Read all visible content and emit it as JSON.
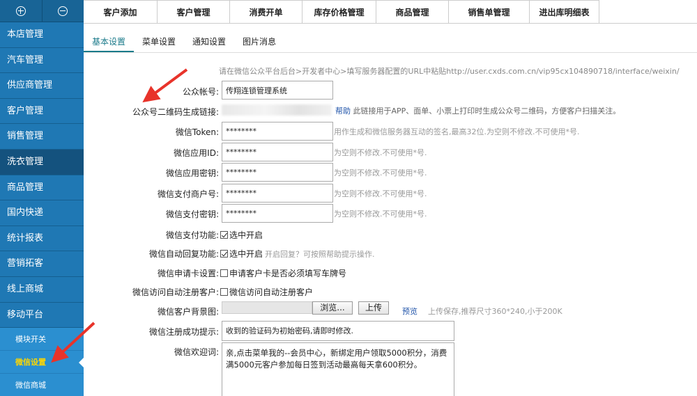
{
  "sidebar": {
    "top_buttons": [
      "plus-icon",
      "minus-icon"
    ],
    "items": [
      {
        "label": "本店管理"
      },
      {
        "label": "汽车管理"
      },
      {
        "label": "供应商管理"
      },
      {
        "label": "客户管理"
      },
      {
        "label": "销售管理"
      },
      {
        "label": "洗衣管理"
      },
      {
        "label": "商品管理"
      },
      {
        "label": "国内快递"
      },
      {
        "label": "统计报表"
      },
      {
        "label": "营销拓客"
      },
      {
        "label": "线上商城"
      },
      {
        "label": "移动平台"
      }
    ],
    "subitems": [
      {
        "label": "模块开关"
      },
      {
        "label": "微信设置"
      },
      {
        "label": "微信商城"
      }
    ]
  },
  "topnav": [
    {
      "label": "客户添加"
    },
    {
      "label": "客户管理"
    },
    {
      "label": "消费开单"
    },
    {
      "label": "库存价格管理"
    },
    {
      "label": "商品管理"
    },
    {
      "label": "销售单管理"
    },
    {
      "label": "进出库明细表"
    }
  ],
  "tabs": [
    {
      "label": "基本设置"
    },
    {
      "label": "菜单设置"
    },
    {
      "label": "通知设置"
    },
    {
      "label": "图片消息"
    }
  ],
  "form": {
    "hint_top": "请在微信公众平台后台>开发者中心>填写服务器配置的URL中粘贴http://user.cxds.com.cn/vip95cx104890718/interface/weixin/",
    "account_label": "公众帐号:",
    "account_value": "传翔连锁管理系统",
    "qr_label": "公众号二维码生成链接:",
    "qr_help": "帮助",
    "qr_note": "此链接用于APP、面单、小票上打印时生成公众号二维码，方便客户扫描关注。",
    "token_label": "微信Token:",
    "token_value": "********",
    "token_note": "用作生成和微信服务器互动的签名,最高32位.为空则不修改.不可使用*号.",
    "appid_label": "微信应用ID:",
    "appid_value": "********",
    "appid_note": "为空则不修改.不可使用*号.",
    "appsecret_label": "微信应用密钥:",
    "appsecret_value": "********",
    "appsecret_note": "为空则不修改.不可使用*号.",
    "mchid_label": "微信支付商户号:",
    "mchid_value": "********",
    "mchid_note": "为空则不修改.不可使用*号.",
    "paykey_label": "微信支付密钥:",
    "paykey_value": "********",
    "paykey_note": "为空则不修改.不可使用*号.",
    "payfunc_label": "微信支付功能:",
    "payfunc_check": "选中开启",
    "autoreply_label": "微信自动回复功能:",
    "autoreply_check": "选中开启",
    "autoreply_note": "开启回复？可按照帮助提示操作.",
    "card_label": "微信申请卡设置:",
    "card_check": "申请客户卡是否必须填写车牌号",
    "autoreg_label": "微信访问自动注册客户:",
    "autoreg_check": "微信访问自动注册客户",
    "bg_label": "微信客户背景图:",
    "browse_btn": "浏览...",
    "upload_btn": "上传",
    "preview_link": "预览",
    "bg_note": "上传保存,推荐尺寸360*240,小于200K",
    "regok_label": "微信注册成功提示:",
    "regok_value": "收到的验证码为初始密码,请即时修改.",
    "welcome_label": "微信欢迎词:",
    "welcome_value": "亲,点击菜单我的--会员中心，新绑定用户领取5000积分，消费满5000元客户参加每日签到活动最高每天拿600积分。"
  },
  "colors": {
    "sidebar": "#1f78b4",
    "sidebar_dark": "#14527e",
    "sub_active": "#ffd700",
    "tab_active": "#1a7a8a",
    "arrow": "#e8332a"
  }
}
